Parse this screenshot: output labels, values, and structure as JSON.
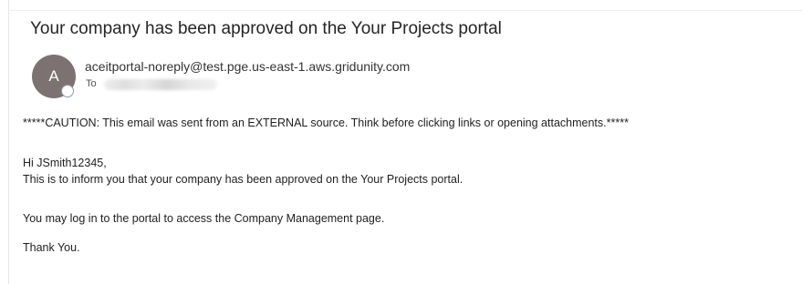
{
  "email": {
    "subject": "Your company has been approved on the Your Projects portal",
    "avatar_initial": "A",
    "sender": "aceitportal-noreply@test.pge.us-east-1.aws.gridunity.com",
    "to_label": "To",
    "caution": "*****CAUTION: This email was sent from an EXTERNAL source. Think before clicking links or opening attachments.*****",
    "greeting": "Hi JSmith12345,",
    "line1": "This is to inform you that your company has been approved on the Your Projects portal.",
    "line2": "You may log in to the portal to access the Company Management page.",
    "closing": "Thank You."
  },
  "colors": {
    "avatar_bg": "#7d7272",
    "text": "#222222",
    "presence_ring": "#8b9ba8"
  }
}
